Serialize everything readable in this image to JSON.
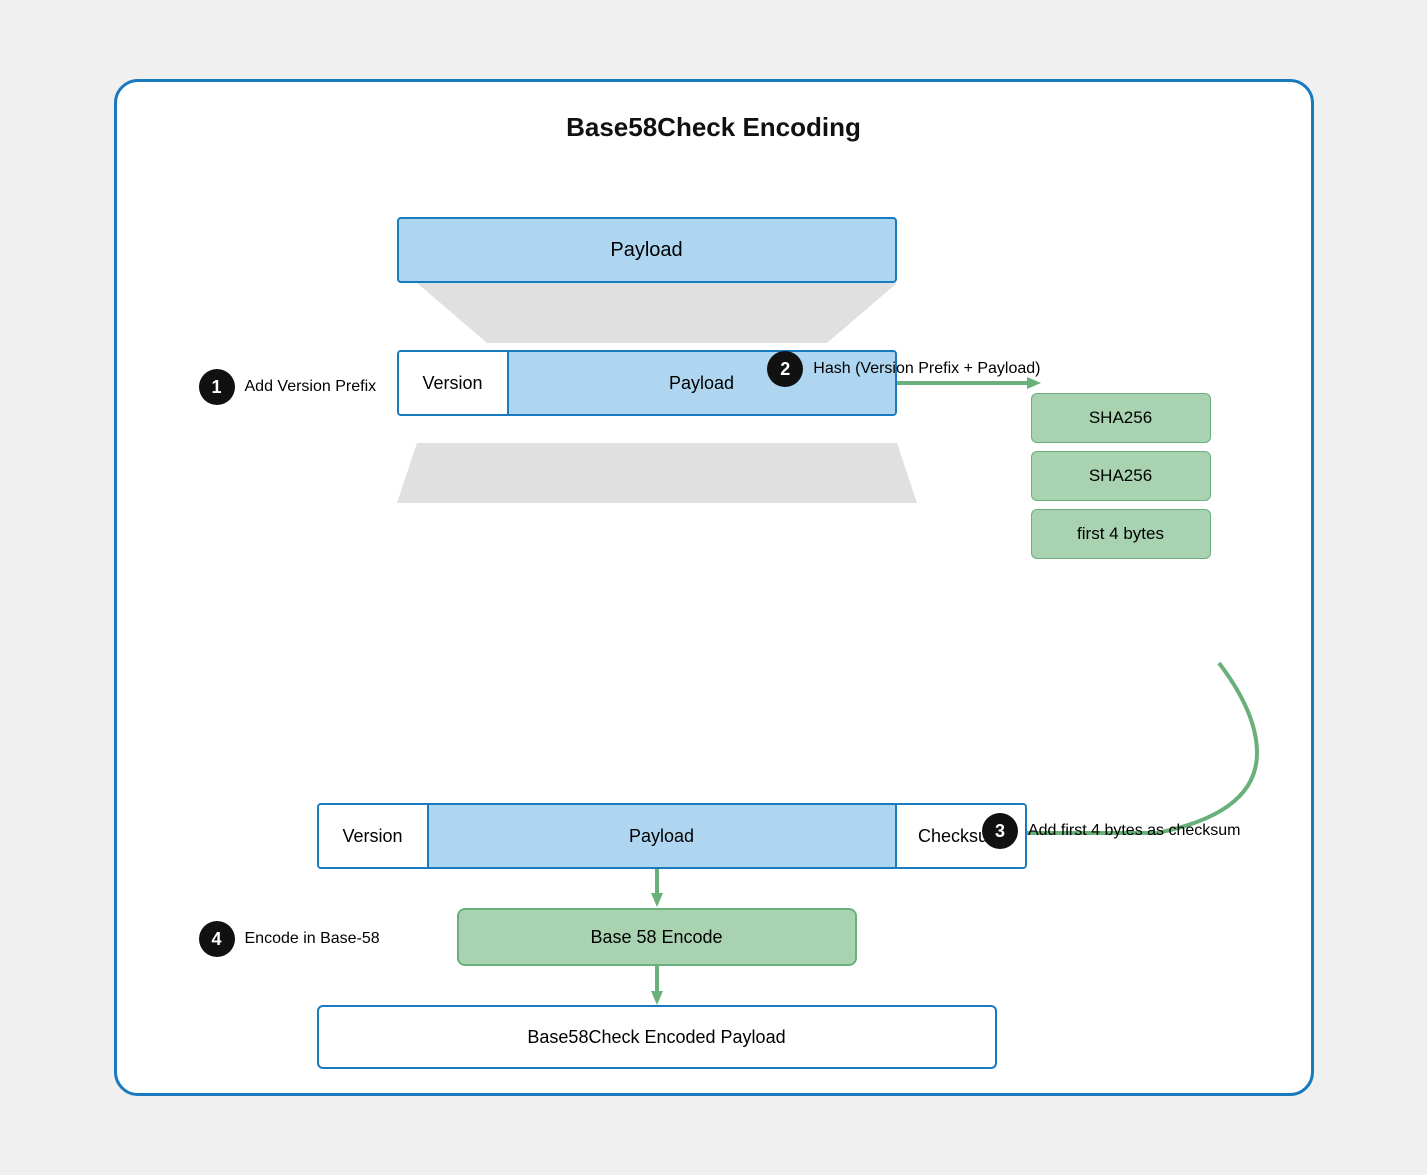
{
  "title": "Base58Check Encoding",
  "steps": {
    "step1": {
      "badge": "1",
      "label": "Add Version Prefix"
    },
    "step2": {
      "badge": "2",
      "label": "Hash (Version Prefix + Payload)"
    },
    "step3": {
      "badge": "3",
      "label": "Add first 4 bytes as checksum"
    },
    "step4": {
      "badge": "4",
      "label": "Encode in Base-58"
    }
  },
  "boxes": {
    "payload_top": "Payload",
    "version": "Version",
    "payload_mid": "Payload",
    "version2": "Version",
    "payload_bot": "Payload",
    "checksum": "Checksum",
    "sha256_1": "SHA256",
    "sha256_2": "SHA256",
    "first4bytes": "first 4 bytes",
    "base58encode": "Base 58 Encode",
    "final": "Base58Check Encoded Payload"
  },
  "colors": {
    "blue_border": "#1a7abf",
    "blue_fill": "#aed6f1",
    "green_fill": "#a9d3b0",
    "green_border": "#6ab07a",
    "grey_funnel": "#e8e8e8",
    "black": "#111111"
  }
}
